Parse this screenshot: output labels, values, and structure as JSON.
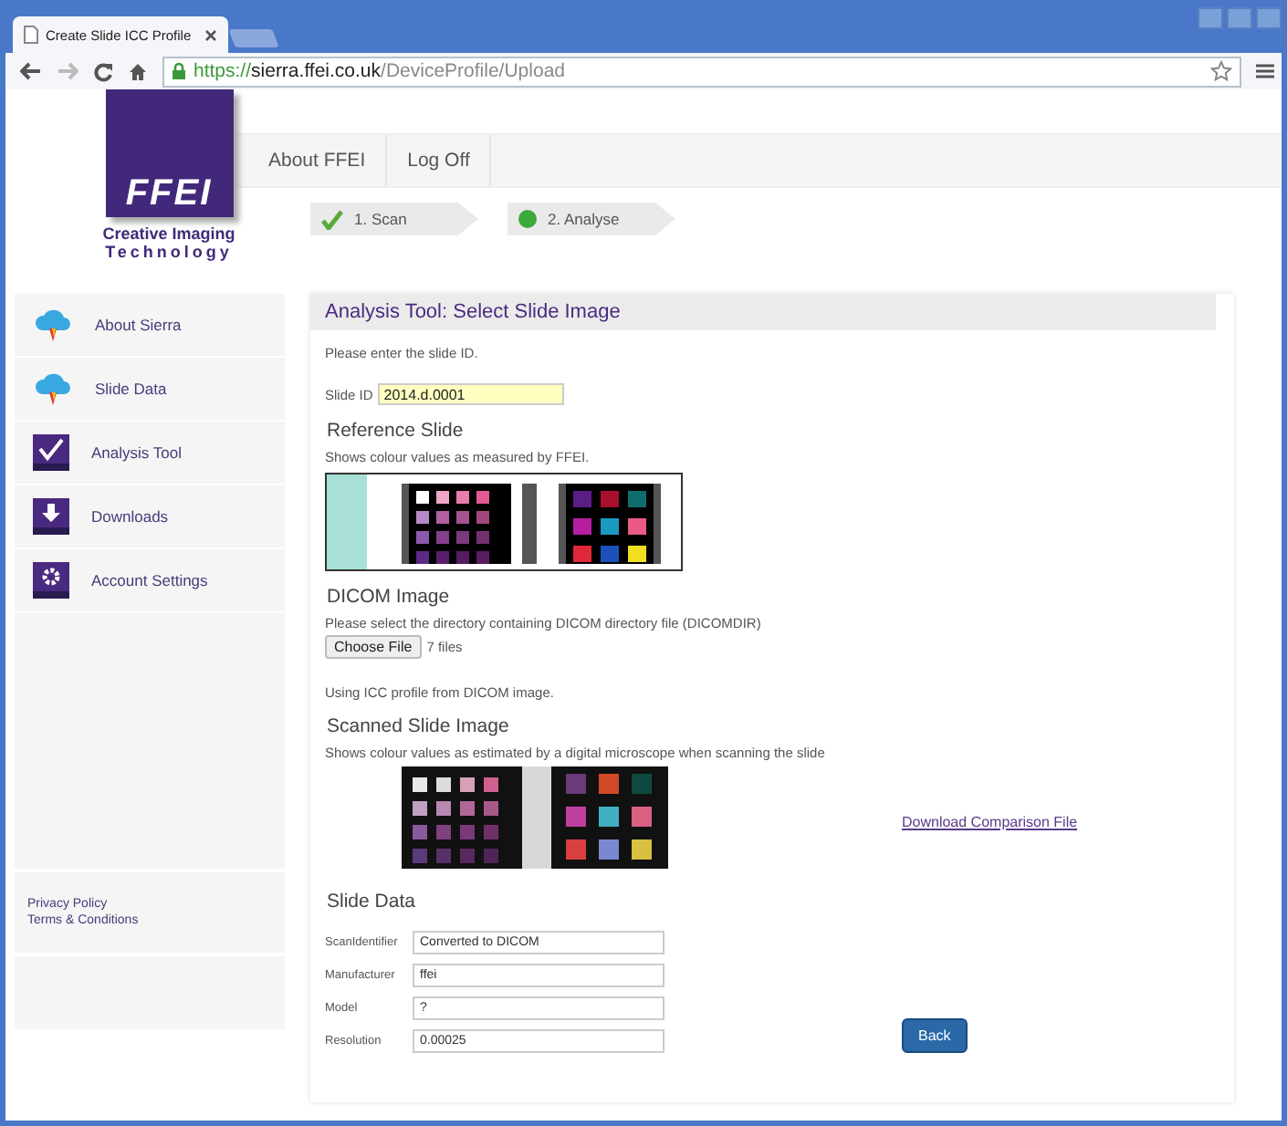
{
  "browser": {
    "tabs": [
      {
        "title": "Create Slide ICC Profile",
        "selected": true
      },
      {
        "selected": false
      }
    ],
    "url_scheme": "https://",
    "url_host": "sierra.ffei.co.uk",
    "url_path": "/DeviceProfile/Upload"
  },
  "logo": {
    "wordmark": "FFEI",
    "tagline": [
      "Creative Imaging",
      "Technology"
    ]
  },
  "nav": [
    "About FFEI",
    "Log Off"
  ],
  "steps": [
    {
      "label": "1. Scan",
      "kind": "done"
    },
    {
      "label": "2. Analyse",
      "kind": "current"
    }
  ],
  "sidebar": {
    "items": [
      {
        "label": "About Sierra",
        "kind": "cloud"
      },
      {
        "label": "Slide Data",
        "kind": "cloud"
      },
      {
        "label": "Analysis Tool",
        "kind": "check"
      },
      {
        "label": "Downloads",
        "kind": "download"
      },
      {
        "label": "Account Settings",
        "kind": "gear"
      }
    ],
    "footer_links": [
      "Privacy Policy",
      "Terms & Conditions"
    ]
  },
  "main": {
    "title": "Analysis Tool: Select Slide Image",
    "prompt": "Please enter the slide ID.",
    "slide_id": {
      "label": "Slide ID",
      "value": "2014.d.0001"
    },
    "reference": {
      "heading": "Reference Slide",
      "description": "Shows colour values as measured by FFEI."
    },
    "dicom": {
      "heading": "DICOM Image",
      "description": "Please select the directory containing DICOM directory file (DICOMDIR)",
      "button": "Choose File",
      "file_count": "7 files",
      "note": "Using ICC profile from DICOM image."
    },
    "scanned": {
      "heading": "Scanned Slide Image",
      "description": "Shows colour values as estimated by a digital microscope when scanning the slide",
      "link": "Download Comparison File"
    },
    "slide_data": {
      "heading": "Slide Data",
      "fields": [
        {
          "label": "ScanIdentifier",
          "value": "Converted to DICOM"
        },
        {
          "label": "Manufacturer",
          "value": "ffei"
        },
        {
          "label": "Model",
          "value": "?"
        },
        {
          "label": "Resolution",
          "value": "0.00025"
        }
      ],
      "button": "Back"
    }
  }
}
